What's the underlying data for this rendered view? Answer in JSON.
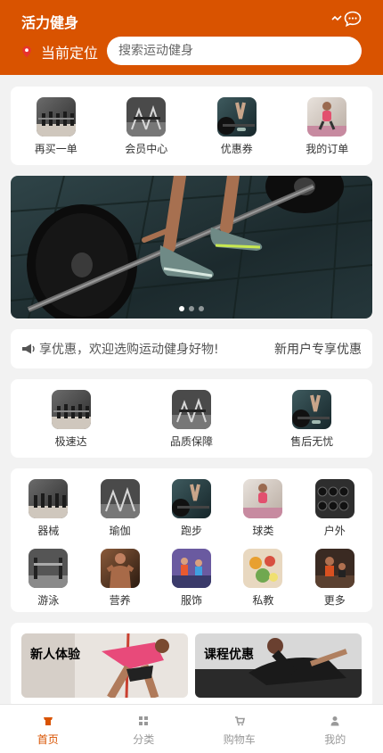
{
  "app": {
    "title": "活力健身",
    "accent": "#d95300"
  },
  "header": {
    "location_label": "当前定位",
    "search_placeholder": "搜索运动健身",
    "icons": [
      "signal-icon",
      "chat-bubble-icon"
    ]
  },
  "quick_actions": [
    {
      "label": "再买一单",
      "icon": "dumbbell-rack-image"
    },
    {
      "label": "会员中心",
      "icon": "gym-machine-image"
    },
    {
      "label": "优惠券",
      "icon": "deadlift-image"
    },
    {
      "label": "我的订单",
      "icon": "fitness-woman-image"
    }
  ],
  "banner": {
    "image": "barbell-deadlift-photo",
    "slides": 3,
    "active_slide": 1
  },
  "notice": {
    "text": "享优惠，欢迎选购运动健身好物!",
    "right_label": "新用户专享优惠",
    "icon": "megaphone-icon"
  },
  "services": [
    {
      "label": "极速达"
    },
    {
      "label": "品质保障"
    },
    {
      "label": "售后无忧"
    }
  ],
  "categories": [
    {
      "label": "器械"
    },
    {
      "label": "瑜伽"
    },
    {
      "label": "跑步"
    },
    {
      "label": "球类"
    },
    {
      "label": "户外"
    },
    {
      "label": "游泳"
    },
    {
      "label": "营养"
    },
    {
      "label": "服饰"
    },
    {
      "label": "私教"
    },
    {
      "label": "更多"
    }
  ],
  "promos": [
    {
      "label": "新人体验"
    },
    {
      "label": "课程优惠"
    }
  ],
  "tabbar": [
    {
      "label": "首页",
      "icon": "home-icon",
      "active": true
    },
    {
      "label": "分类",
      "icon": "grid-icon",
      "active": false
    },
    {
      "label": "购物车",
      "icon": "cart-icon",
      "active": false
    },
    {
      "label": "我的",
      "icon": "user-icon",
      "active": false
    }
  ]
}
